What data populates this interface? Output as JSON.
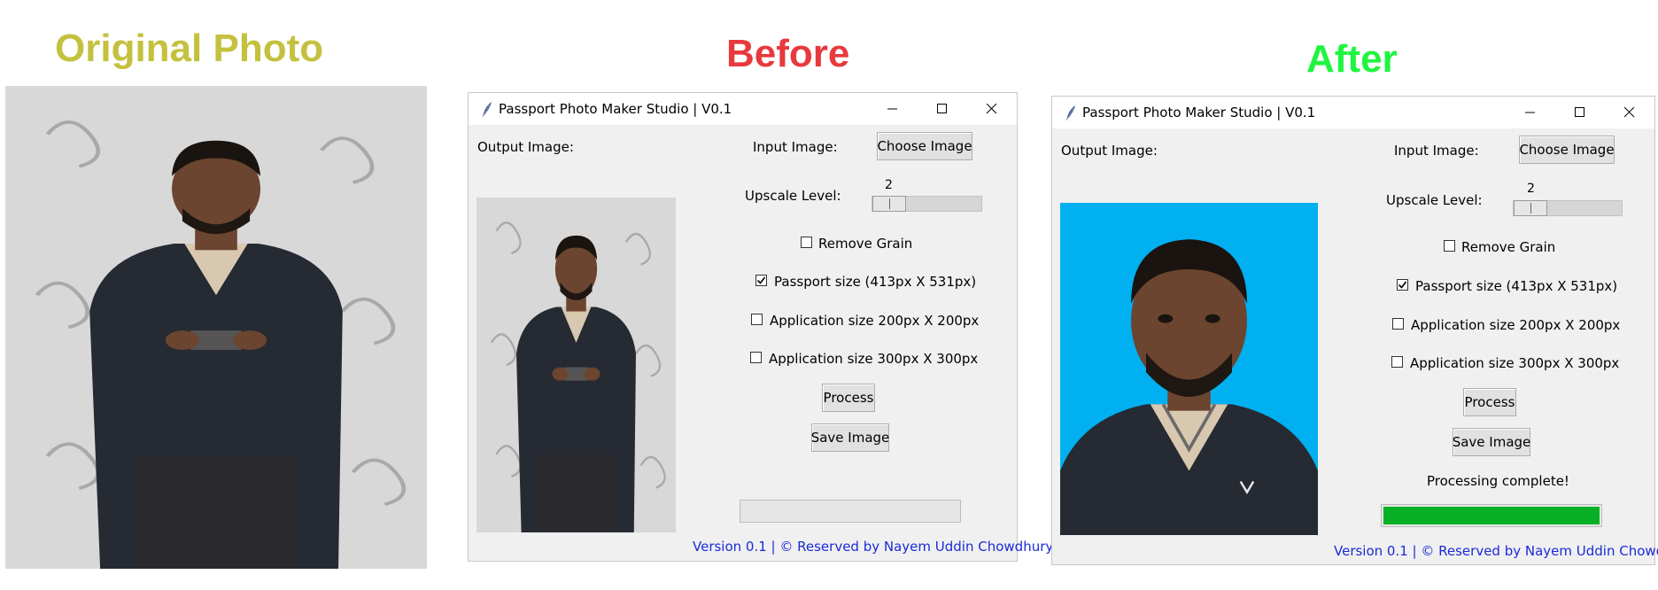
{
  "headings": {
    "original": "Original Photo",
    "before": "Before",
    "after": "After"
  },
  "colors": {
    "original_heading": "#c4c13f",
    "before_heading": "#e8393d",
    "after_heading": "#1ff53f",
    "footer_text": "#1a2bd6",
    "progress_fill": "#06b025",
    "passport_background": "#00b0f0"
  },
  "app": {
    "title": "Passport Photo Maker Studio | V0.1",
    "output_label": "Output Image:",
    "input_label": "Input Image:",
    "choose_button": "Choose Image",
    "upscale_label": "Upscale Level:",
    "upscale_value": "2",
    "remove_grain": "Remove Grain",
    "passport_size": "Passport size (413px X 531px)",
    "app_size_200": "Application size 200px X 200px",
    "app_size_300": "Application size  300px X 300px",
    "process_button": "Process",
    "save_button": "Save Image",
    "footer": "Version 0.1 | © Reserved by Nayem Uddin Chowdhury"
  },
  "before_state": {
    "remove_grain_checked": false,
    "passport_checked": true,
    "app200_checked": false,
    "app300_checked": false,
    "status": "",
    "progress": 0
  },
  "after_state": {
    "remove_grain_checked": false,
    "passport_checked": true,
    "app200_checked": false,
    "app300_checked": false,
    "status": "Processing complete!",
    "progress": 1.0
  },
  "icons": [
    "feather-icon",
    "minimize-icon",
    "maximize-icon",
    "close-icon",
    "checkmark-icon"
  ]
}
